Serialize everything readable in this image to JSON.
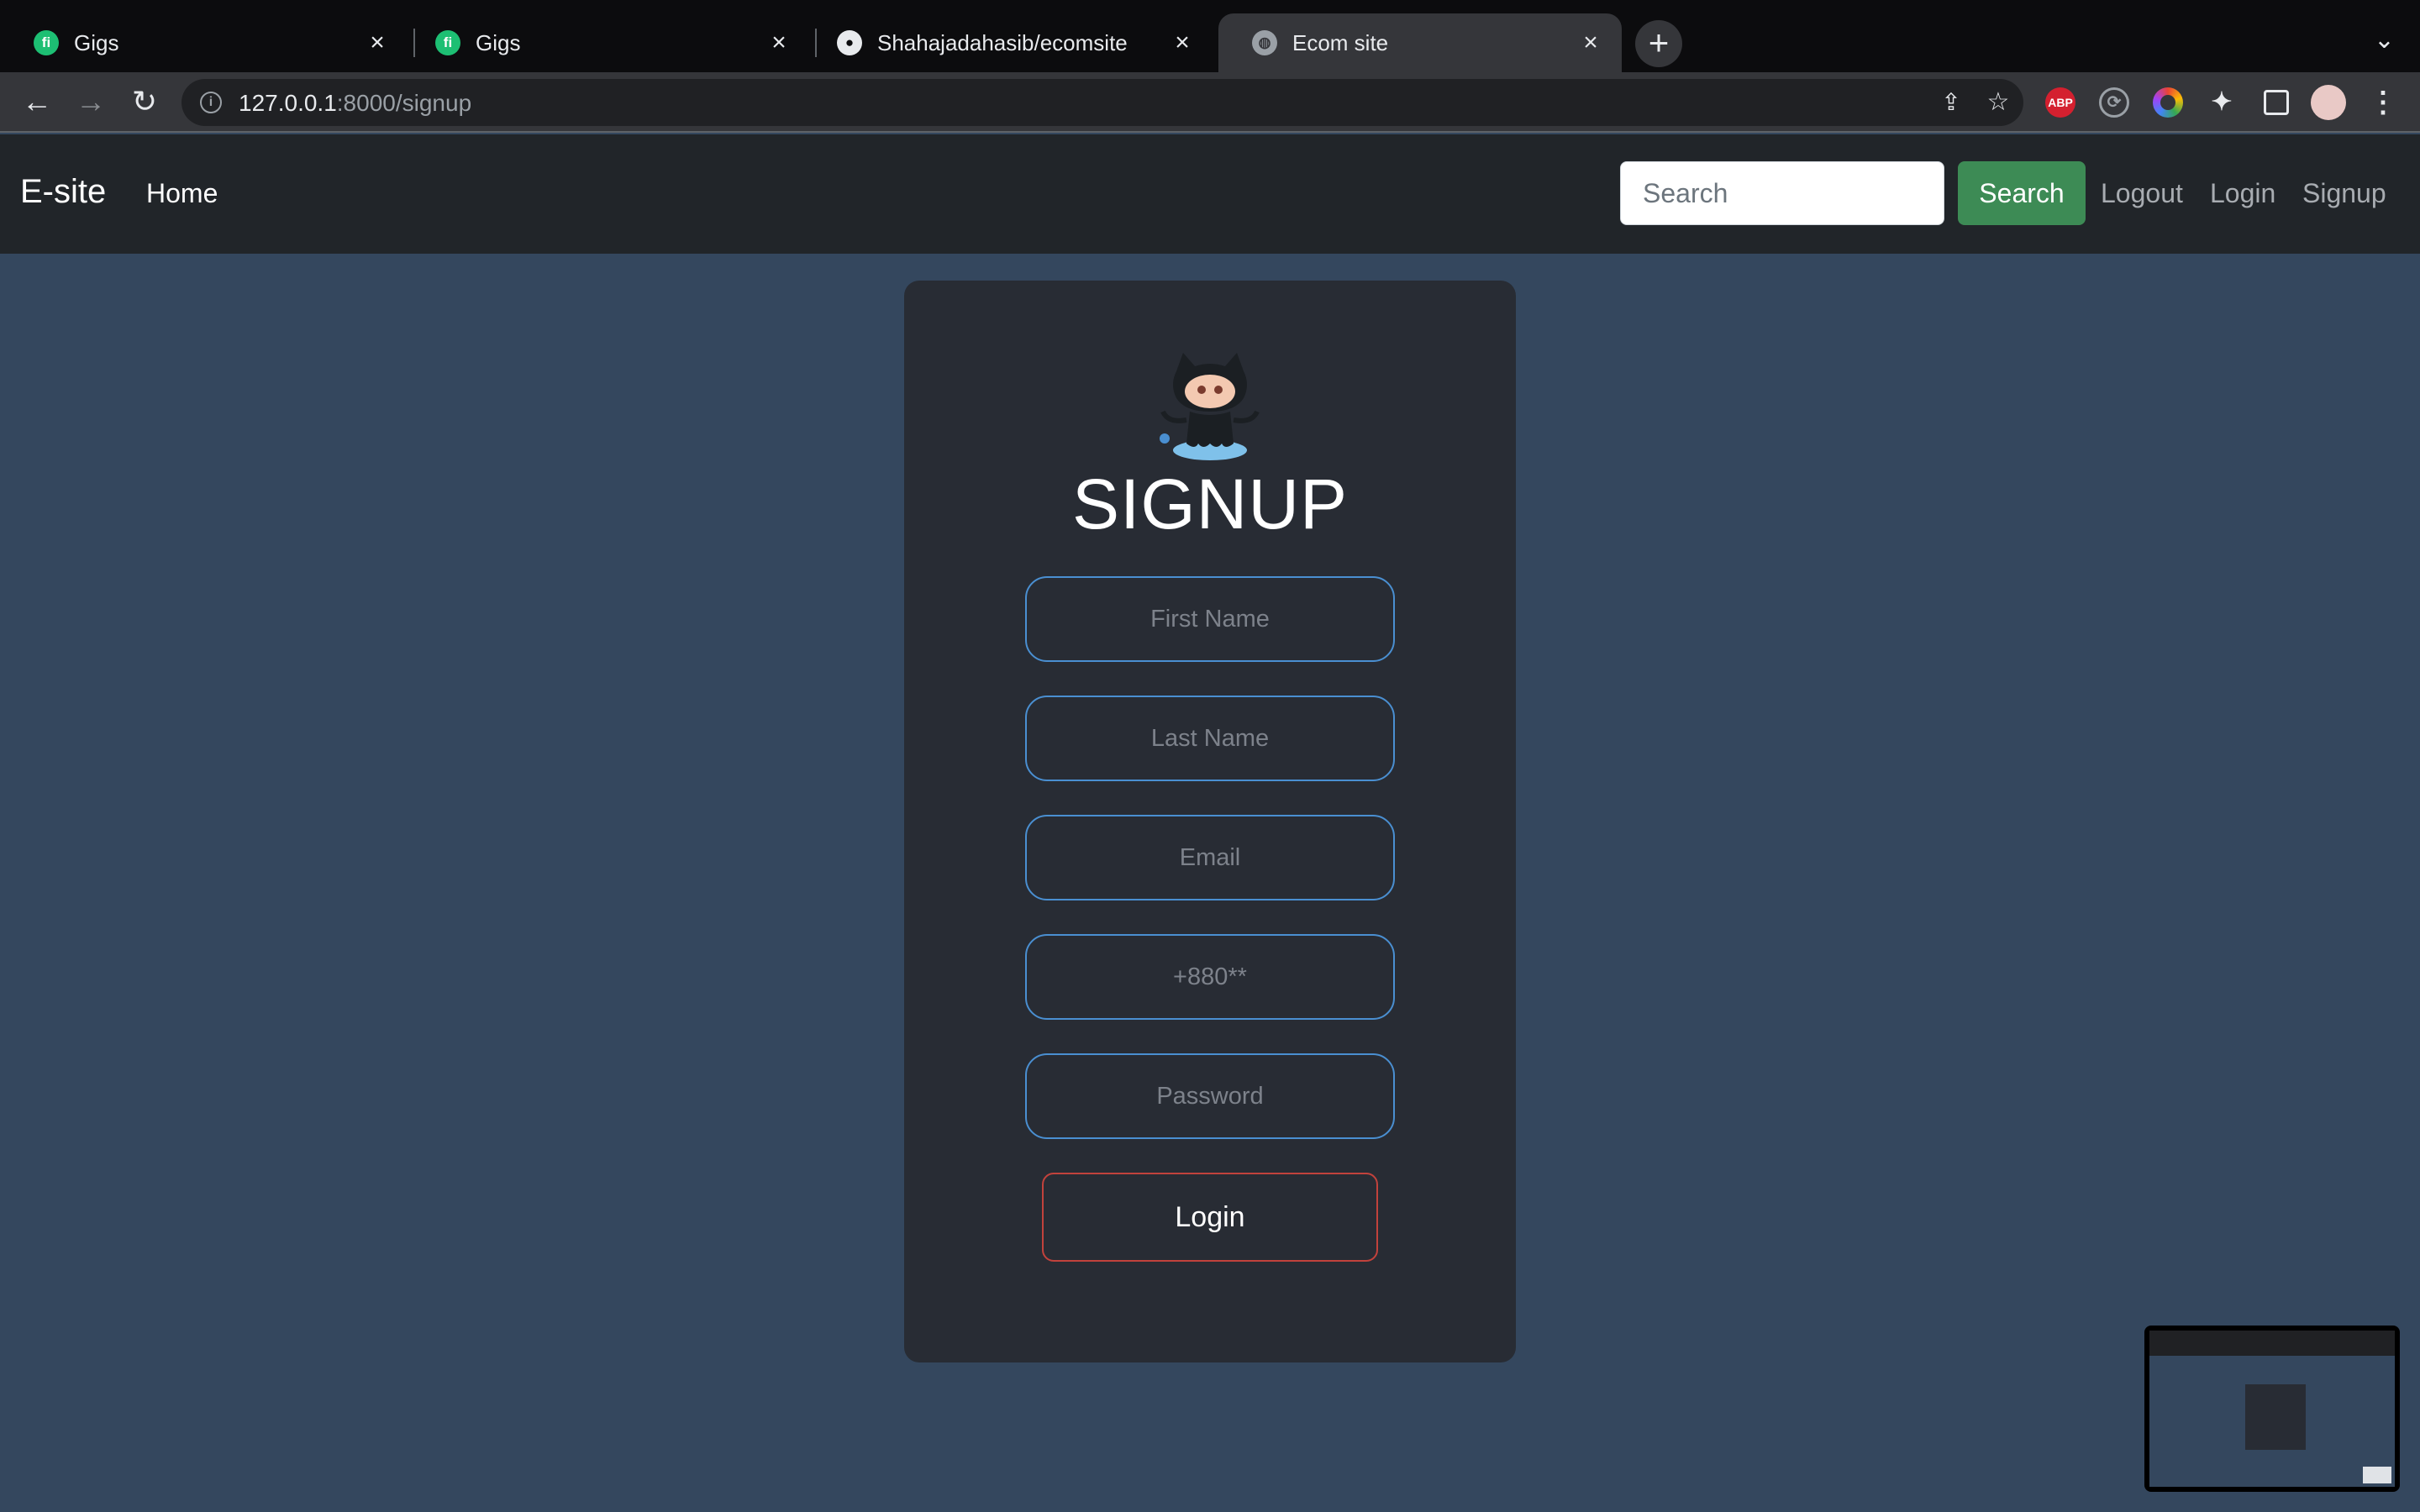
{
  "browser": {
    "tabs": [
      {
        "title": "Gigs",
        "favicon": "fiverr-icon"
      },
      {
        "title": "Gigs",
        "favicon": "fiverr-icon"
      },
      {
        "title": "Shahajadahasib/ecomsite",
        "favicon": "github-icon"
      },
      {
        "title": "Ecom site",
        "favicon": "globe-icon"
      }
    ],
    "url_host": "127.0.0.1",
    "url_path": ":8000/signup",
    "extensions": {
      "abp": "ABP"
    }
  },
  "navbar": {
    "brand": "E-site",
    "home": "Home",
    "search_placeholder": "Search",
    "search_button": "Search",
    "links": {
      "logout": "Logout",
      "login": "Login",
      "signup": "Signup"
    }
  },
  "signup": {
    "heading": "SIGNUP",
    "first_name_placeholder": "First Name",
    "last_name_placeholder": "Last Name",
    "email_placeholder": "Email",
    "phone_placeholder": "+880**",
    "password_placeholder": "Password",
    "submit_label": "Login"
  },
  "colors": {
    "page_background": "#34475e",
    "navbar_background": "#212529",
    "card_background": "#282c34",
    "search_button": "#3d8b55",
    "input_border": "#4a8fd1",
    "submit_border": "#c2423c"
  }
}
